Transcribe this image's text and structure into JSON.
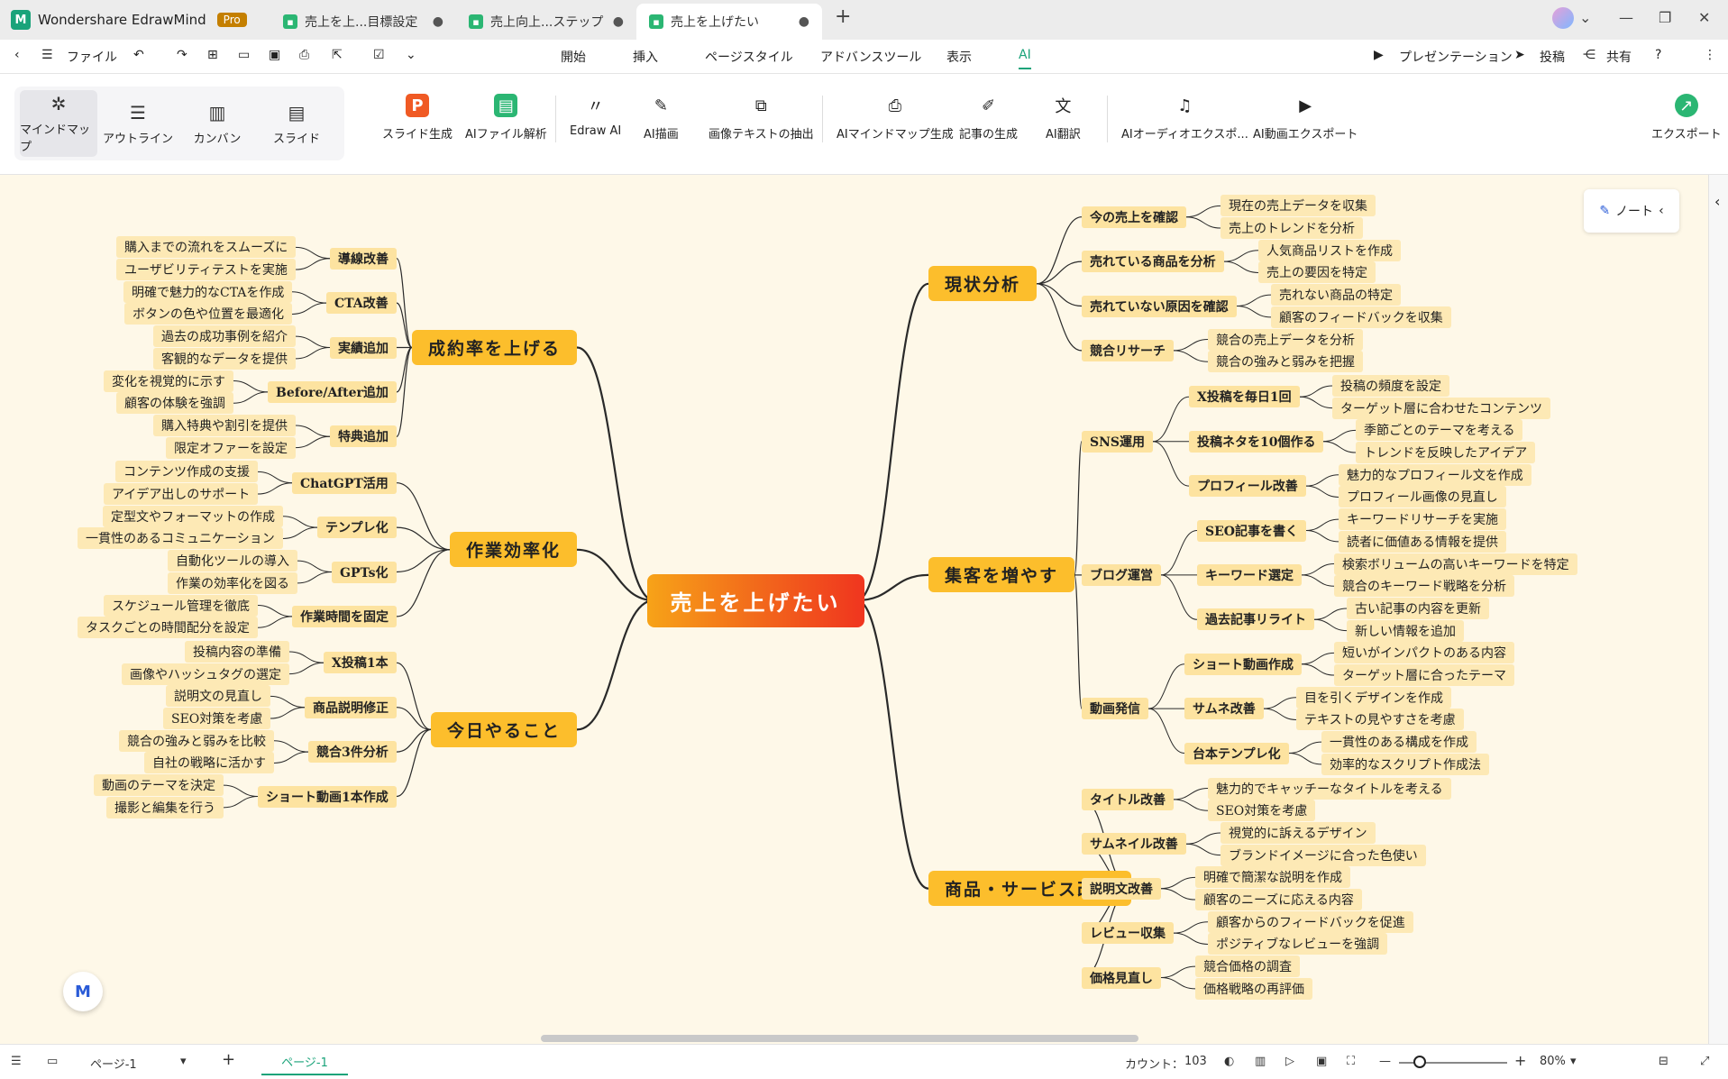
{
  "app": {
    "name": "Wondershare EdrawMind",
    "badge": "Pro"
  },
  "tabs": [
    {
      "label": "売上を上...目標設定"
    },
    {
      "label": "売上向上...ステップ"
    },
    {
      "label": "売上を上げたい"
    }
  ],
  "menu": {
    "file": "ファイル",
    "tabs": [
      "開始",
      "挿入",
      "ページスタイル",
      "アドバンスツール",
      "表示",
      "AI"
    ],
    "active_tab": "AI",
    "right": {
      "present": "プレゼンテーション",
      "publish": "投稿",
      "share": "共有"
    }
  },
  "ribbon": {
    "views": [
      {
        "label": "マインドマップ",
        "icon": "mindmap-icon"
      },
      {
        "label": "アウトライン",
        "icon": "outline-icon"
      },
      {
        "label": "カンバン",
        "icon": "kanban-icon"
      },
      {
        "label": "スライド",
        "icon": "slide-icon"
      }
    ],
    "tools": [
      {
        "label": "スライド生成",
        "icon": "slide-generate-icon"
      },
      {
        "label": "AIファイル解析",
        "icon": "ai-file-analysis-icon"
      },
      {
        "label": "Edraw AI",
        "icon": "edraw-ai-icon"
      },
      {
        "label": "AI描画",
        "icon": "ai-drawing-icon"
      },
      {
        "label": "画像テキストの抽出",
        "icon": "image-text-extract-icon"
      },
      {
        "label": "AIマインドマップ生成",
        "icon": "ai-mindmap-generate-icon"
      },
      {
        "label": "記事の生成",
        "icon": "article-generate-icon"
      },
      {
        "label": "AI翻訳",
        "icon": "ai-translate-icon"
      },
      {
        "label": "AIオーディオエクスポ...",
        "icon": "ai-audio-export-icon"
      },
      {
        "label": "AI動画エクスポート",
        "icon": "ai-video-export-icon"
      }
    ],
    "export": "エクスポート"
  },
  "note_button": "ノート",
  "mindmap": {
    "root": "売上を上げたい",
    "right": [
      {
        "label": "現状分析",
        "children": [
          {
            "label": "今の売上を確認",
            "children": [
              "現在の売上データを収集",
              "売上のトレンドを分析"
            ]
          },
          {
            "label": "売れている商品を分析",
            "children": [
              "人気商品リストを作成",
              "売上の要因を特定"
            ]
          },
          {
            "label": "売れていない原因を確認",
            "children": [
              "売れない商品の特定",
              "顧客のフィードバックを収集"
            ]
          },
          {
            "label": "競合リサーチ",
            "children": [
              "競合の売上データを分析",
              "競合の強みと弱みを把握"
            ]
          }
        ]
      },
      {
        "label": "集客を増やす",
        "children": [
          {
            "label": "SNS運用",
            "children": [
              {
                "label": "X投稿を毎日1回",
                "children": [
                  "投稿の頻度を設定",
                  "ターゲット層に合わせたコンテンツ"
                ]
              },
              {
                "label": "投稿ネタを10個作る",
                "children": [
                  "季節ごとのテーマを考える",
                  "トレンドを反映したアイデア"
                ]
              },
              {
                "label": "プロフィール改善",
                "children": [
                  "魅力的なプロフィール文を作成",
                  "プロフィール画像の見直し"
                ]
              }
            ]
          },
          {
            "label": "ブログ運営",
            "children": [
              {
                "label": "SEO記事を書く",
                "children": [
                  "キーワードリサーチを実施",
                  "読者に価値ある情報を提供"
                ]
              },
              {
                "label": "キーワード選定",
                "children": [
                  "検索ボリュームの高いキーワードを特定",
                  "競合のキーワード戦略を分析"
                ]
              },
              {
                "label": "過去記事リライト",
                "children": [
                  "古い記事の内容を更新",
                  "新しい情報を追加"
                ]
              }
            ]
          },
          {
            "label": "動画発信",
            "children": [
              {
                "label": "ショート動画作成",
                "children": [
                  "短いがインパクトのある内容",
                  "ターゲット層に合ったテーマ"
                ]
              },
              {
                "label": "サムネ改善",
                "children": [
                  "目を引くデザインを作成",
                  "テキストの見やすさを考慮"
                ]
              },
              {
                "label": "台本テンプレ化",
                "children": [
                  "一貫性のある構成を作成",
                  "効率的なスクリプト作成法"
                ]
              }
            ]
          }
        ]
      },
      {
        "label": "商品・サービス改善",
        "children": [
          {
            "label": "タイトル改善",
            "children": [
              "魅力的でキャッチーなタイトルを考える",
              "SEO対策を考慮"
            ]
          },
          {
            "label": "サムネイル改善",
            "children": [
              "視覚的に訴えるデザイン",
              "ブランドイメージに合った色使い"
            ]
          },
          {
            "label": "説明文改善",
            "children": [
              "明確で簡潔な説明を作成",
              "顧客のニーズに応える内容"
            ]
          },
          {
            "label": "レビュー収集",
            "children": [
              "顧客からのフィードバックを促進",
              "ポジティブなレビューを強調"
            ]
          },
          {
            "label": "価格見直し",
            "children": [
              "競合価格の調査",
              "価格戦略の再評価"
            ]
          }
        ]
      }
    ],
    "left": [
      {
        "label": "成約率を上げる",
        "children": [
          {
            "label": "導線改善",
            "children": [
              "購入までの流れをスムーズに",
              "ユーザビリティテストを実施"
            ]
          },
          {
            "label": "CTA改善",
            "children": [
              "明確で魅力的なCTAを作成",
              "ボタンの色や位置を最適化"
            ]
          },
          {
            "label": "実績追加",
            "children": [
              "過去の成功事例を紹介",
              "客観的なデータを提供"
            ]
          },
          {
            "label": "Before/After追加",
            "children": [
              "変化を視覚的に示す",
              "顧客の体験を強調"
            ]
          },
          {
            "label": "特典追加",
            "children": [
              "購入特典や割引を提供",
              "限定オファーを設定"
            ]
          }
        ]
      },
      {
        "label": "作業効率化",
        "children": [
          {
            "label": "ChatGPT活用",
            "children": [
              "コンテンツ作成の支援",
              "アイデア出しのサポート"
            ]
          },
          {
            "label": "テンプレ化",
            "children": [
              "定型文やフォーマットの作成",
              "一貫性のあるコミュニケーション"
            ]
          },
          {
            "label": "GPTs化",
            "children": [
              "自動化ツールの導入",
              "作業の効率化を図る"
            ]
          },
          {
            "label": "作業時間を固定",
            "children": [
              "スケジュール管理を徹底",
              "タスクごとの時間配分を設定"
            ]
          }
        ]
      },
      {
        "label": "今日やること",
        "children": [
          {
            "label": "X投稿1本",
            "children": [
              "投稿内容の準備",
              "画像やハッシュタグの選定"
            ]
          },
          {
            "label": "商品説明修正",
            "children": [
              "説明文の見直し",
              "SEO対策を考慮"
            ]
          },
          {
            "label": "競合3件分析",
            "children": [
              "競合の強みと弱みを比較",
              "自社の戦略に活かす"
            ]
          },
          {
            "label": "ショート動画1本作成",
            "children": [
              "動画のテーマを決定",
              "撮影と編集を行う"
            ]
          }
        ]
      }
    ]
  },
  "status": {
    "page_select": "ページ-1",
    "page_tab": "ページ-1",
    "count_label": "カウント：",
    "count_value": "103",
    "zoom": "80%"
  },
  "colors": {
    "accent": "#1aa37a",
    "canvas": "#fef8e8",
    "node": "#fcbe2c",
    "leaf": "#fde9b5"
  }
}
